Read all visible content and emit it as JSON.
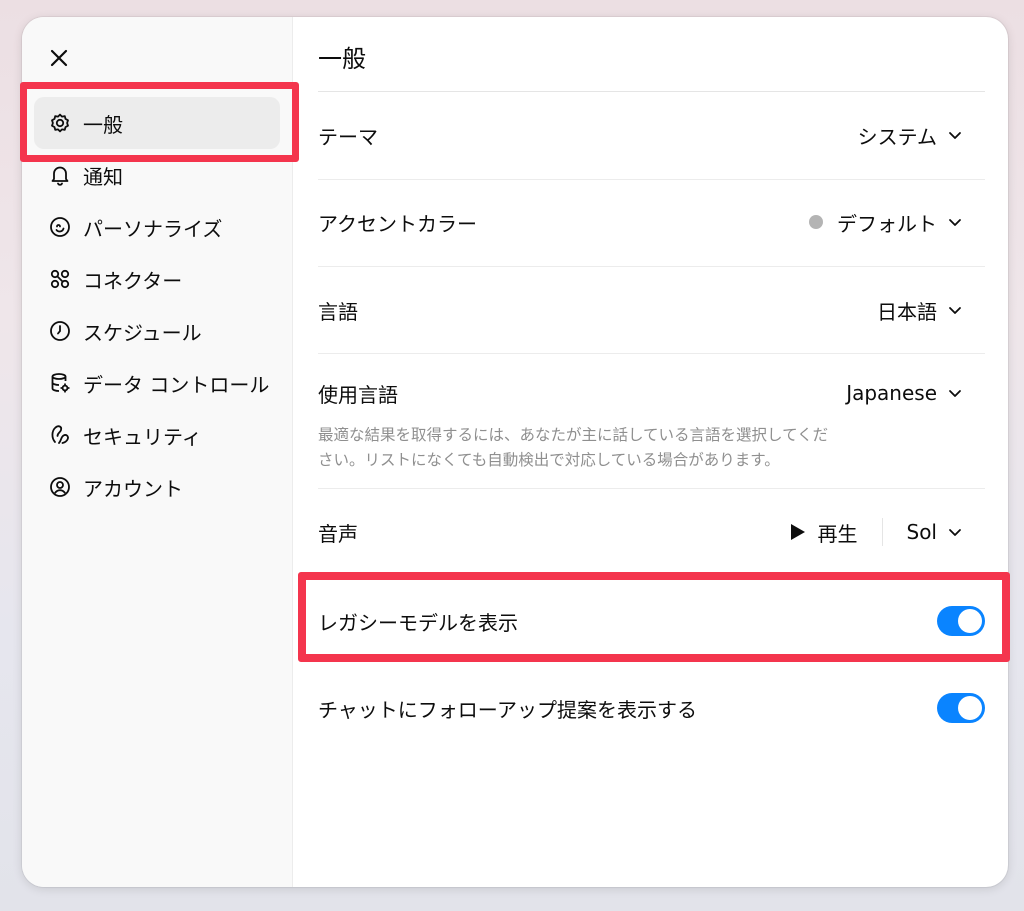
{
  "close": {
    "icon": "close-icon"
  },
  "sidebar": {
    "items": [
      {
        "label": "一般",
        "icon": "gear-icon",
        "active": true
      },
      {
        "label": "通知",
        "icon": "bell-icon"
      },
      {
        "label": "パーソナライズ",
        "icon": "personalize-icon"
      },
      {
        "label": "コネクター",
        "icon": "connectors-icon"
      },
      {
        "label": "スケジュール",
        "icon": "clock-icon"
      },
      {
        "label": "データ コントロール",
        "icon": "database-icon"
      },
      {
        "label": "セキュリティ",
        "icon": "security-icon"
      },
      {
        "label": "アカウント",
        "icon": "account-icon"
      }
    ]
  },
  "main": {
    "title": "一般",
    "theme": {
      "label": "テーマ",
      "value": "システム"
    },
    "accent": {
      "label": "アクセントカラー",
      "value": "デフォルト",
      "dot_color": "#b4b4b4"
    },
    "language": {
      "label": "言語",
      "value": "日本語"
    },
    "spoken_language": {
      "label": "使用言語",
      "value": "Japanese",
      "help_line1": "最適な結果を取得するには、あなたが主に話している言語を選択してくだ",
      "help_line2": "さい。リストになくても自動検出で対応している場合があります。"
    },
    "voice": {
      "label": "音声",
      "play_label": "再生",
      "value": "Sol"
    },
    "legacy_models": {
      "label": "レガシーモデルを表示",
      "on": true
    },
    "follow_up": {
      "label": "チャットにフォローアップ提案を表示する",
      "on": true
    }
  },
  "colors": {
    "toggle_on": "#0a84ff",
    "highlight": "#f4354d"
  }
}
